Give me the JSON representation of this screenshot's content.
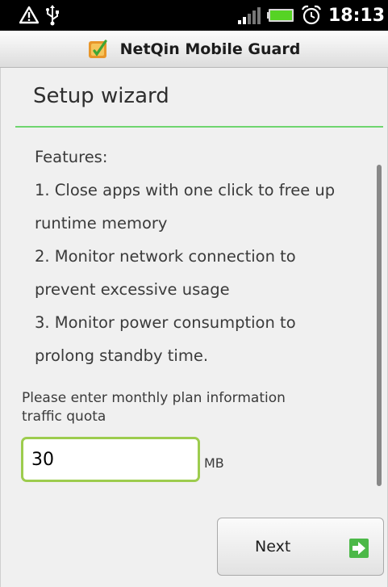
{
  "status_bar": {
    "time": "18:13",
    "icons": [
      "warning-icon",
      "usb-icon",
      "signal-icon",
      "battery-icon",
      "alarm-icon"
    ]
  },
  "app": {
    "title": "NetQin Mobile Guard",
    "icon": "netqin-logo-icon"
  },
  "wizard": {
    "title": "Setup wizard",
    "features": [
      "Features:",
      "1. Close apps with one click to free up",
      "runtime memory",
      "2. Monitor network connection to",
      "prevent excessive usage",
      "3. Monitor power consumption to",
      "prolong standby time."
    ],
    "quota_label_line1": "Please enter monthly plan information",
    "quota_label_line2": "traffic quota",
    "quota_value": "30",
    "quota_unit": "MB",
    "next_label": "Next"
  },
  "colors": {
    "divider": "#6fd56f",
    "input_border": "#9dcc4e",
    "next_arrow": "#4cb848"
  }
}
